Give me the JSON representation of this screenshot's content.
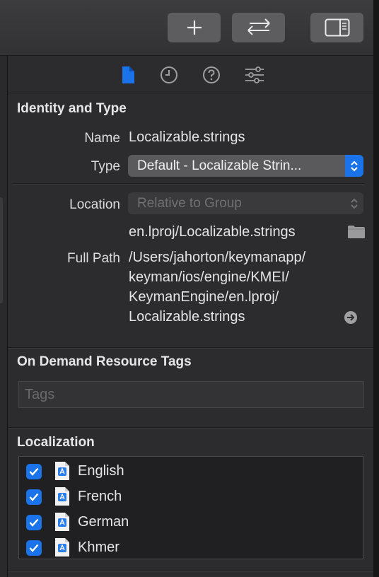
{
  "toolbar": {
    "buttons": [
      {
        "icon": "plus-icon"
      },
      {
        "icon": "swap-arrows-icon"
      },
      {
        "icon": "sidebar-toggle-icon"
      }
    ]
  },
  "inspector": {
    "tabs": [
      {
        "icon": "file-icon",
        "selected": true
      },
      {
        "icon": "history-clock-icon",
        "selected": false
      },
      {
        "icon": "help-question-icon",
        "selected": false
      },
      {
        "icon": "sliders-icon",
        "selected": false
      }
    ],
    "identity": {
      "title": "Identity and Type",
      "name_label": "Name",
      "name_value": "Localizable.strings",
      "type_label": "Type",
      "type_value": "Default - Localizable Strin...",
      "location_label": "Location",
      "location_value": "Relative to Group",
      "relative_path": "en.lproj/Localizable.strings",
      "full_path_label": "Full Path",
      "full_path_lines": [
        "/Users/jahorton/keymanapp/",
        "keyman/ios/engine/KMEI/",
        "KeymanEngine/en.lproj/",
        "Localizable.strings"
      ]
    },
    "on_demand": {
      "title": "On Demand Resource Tags",
      "tags_placeholder": "Tags"
    },
    "localization": {
      "title": "Localization",
      "languages": [
        {
          "name": "English",
          "checked": true
        },
        {
          "name": "French",
          "checked": true
        },
        {
          "name": "German",
          "checked": true
        },
        {
          "name": "Khmer",
          "checked": true
        }
      ]
    }
  },
  "colors": {
    "accent": "#1a73e8",
    "popup_active": "#5a5a5c",
    "popup_disabled": "#3a3a3c"
  }
}
